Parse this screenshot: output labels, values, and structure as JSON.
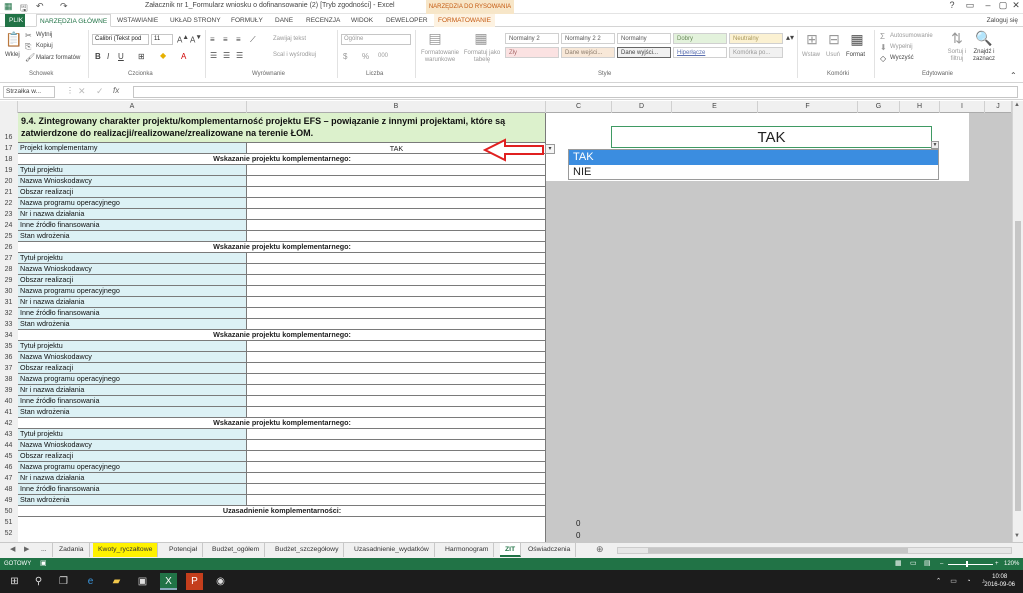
{
  "window": {
    "title": "Załacznik nr 1_Formularz wniosku o dofinansowanie (2) [Tryb zgodności] - Excel",
    "drawing_tools": "NARZĘDZIA DO RYSOWANIA",
    "login": "Zaloguj się"
  },
  "tabs": {
    "file": "PLIK",
    "home": "NARZĘDZIA GŁÓWNE",
    "insert": "WSTAWIANIE",
    "layout": "UKŁAD STRONY",
    "formulas": "FORMUŁY",
    "data": "DANE",
    "review": "RECENZJA",
    "view": "WIDOK",
    "developer": "DEWELOPER",
    "format": "FORMATOWANIE"
  },
  "ribbon": {
    "clipboard": {
      "paste": "Wklej",
      "cut": "Wytnij",
      "copy": "Kopiuj",
      "painter": "Malarz formatów",
      "label": "Schowek"
    },
    "font": {
      "name": "Calibri (Tekst pod",
      "size": "11",
      "label": "Czcionka"
    },
    "alignment": {
      "wrap": "Zawijaj tekst",
      "merge": "Scal i wyśrodkuj",
      "label": "Wyrównanie"
    },
    "number": {
      "format": "Ogólne",
      "label": "Liczba"
    },
    "styles": {
      "cond": "Formatowanie warunkowe",
      "table": "Formatuj jako tabelę",
      "cells": [
        "Normalny 2",
        "Normalny 2 2",
        "Normalny",
        "Dobry",
        "Neutralny",
        "Zły",
        "Dane wejści...",
        "Dane wyjści...",
        "Hiperłącze",
        "Komórka po..."
      ],
      "label": "Style"
    },
    "cells_group": {
      "insert": "Wstaw",
      "delete": "Usuń",
      "format": "Format",
      "label": "Komórki"
    },
    "editing": {
      "autosum": "Autosumowanie",
      "fill": "Wypełnij",
      "clear": "Wyczyść",
      "sort": "Sortuj i filtruj",
      "find": "Znajdź i zaznacz",
      "label": "Edytowanie"
    }
  },
  "formula_bar": {
    "name_box": "Strzałka w..."
  },
  "columns": [
    "A",
    "B",
    "C",
    "D",
    "E",
    "F",
    "G",
    "H",
    "I",
    "J"
  ],
  "sheet": {
    "header": "9.4. Zintegrowany charakter projektu/komplementarność projektu EFS – powiązanie z innymi projektami, które są zatwierdzone do realizacji/realizowane/zrealizowane na terenie ŁOM.",
    "row17_label": "Projekt komplementarny",
    "row17_value": "TAK",
    "section_title": "Wskazanie projektu komplementarnego:",
    "fields": [
      "Tytuł projektu",
      "Nazwa Wnioskodawcy",
      "Obszar realizacji",
      "Nazwa programu operacyjnego",
      "Nr i nazwa działania",
      "Inne źródło finansowania",
      "Stan wdrożenia"
    ],
    "justification": "Uzasadnienie komplementarności:",
    "row_numbers": [
      "16",
      "17",
      "18",
      "19",
      "20",
      "21",
      "22",
      "23",
      "24",
      "25",
      "26",
      "27",
      "28",
      "29",
      "30",
      "31",
      "32",
      "33",
      "34",
      "35",
      "36",
      "37",
      "38",
      "39",
      "40",
      "41",
      "42",
      "43",
      "44",
      "45",
      "46",
      "47",
      "48",
      "49",
      "50",
      "51",
      "52"
    ],
    "side_values": [
      "0",
      "0"
    ]
  },
  "dropdown": {
    "current": "TAK",
    "options": [
      "TAK",
      "NIE"
    ],
    "selected": "TAK"
  },
  "sheet_tabs": [
    "...",
    "Zadania",
    "Kwoty_ryczałtowe",
    "Potencjał",
    "Budżet_ogółem",
    "Budżet_szczegółowy",
    "Uzasadnienie_wydatków",
    "Harmonogram",
    "ZIT",
    "Oświadczenia"
  ],
  "active_sheet": "ZIT",
  "status": {
    "ready": "GOTOWY",
    "zoom": "120%"
  },
  "clock": {
    "time": "10:08",
    "date": "2016-09-06"
  },
  "colors": {
    "excel_green": "#217346",
    "header_fill": "#dcf1cc",
    "label_fill": "#dcf1f5",
    "arrow": "#e02020",
    "highlight": "#3b8de0"
  }
}
